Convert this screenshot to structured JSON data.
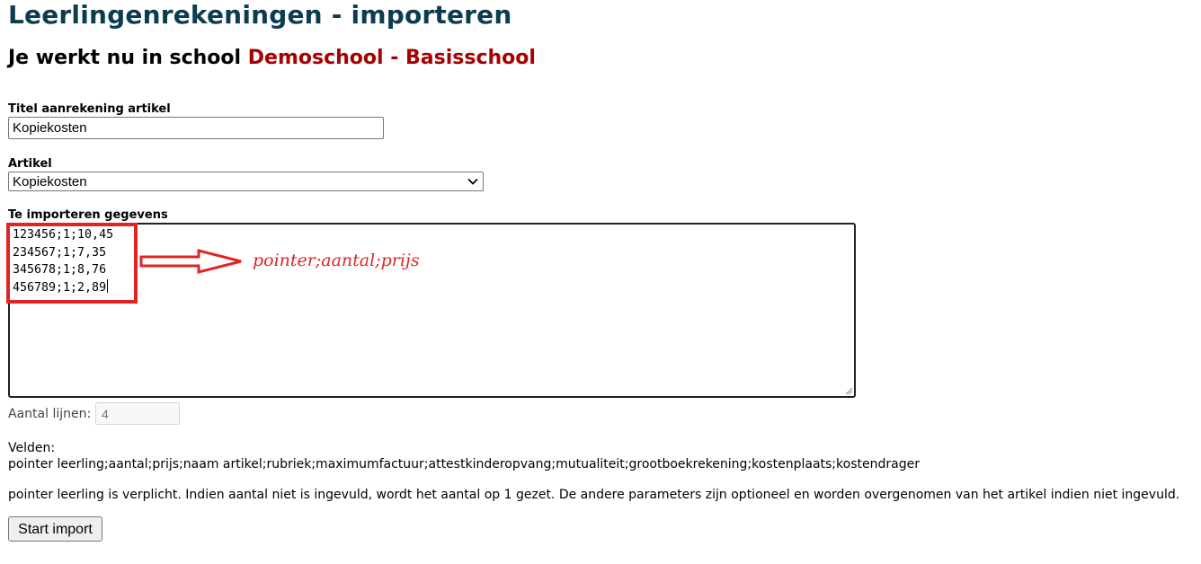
{
  "header": {
    "title": "Leerlingenrekeningen - importeren",
    "school_prefix": "Je werkt nu in school",
    "school_name": "Demoschool - Basisschool"
  },
  "form": {
    "title_label": "Titel aanrekening artikel",
    "title_value": "Kopiekosten",
    "article_label": "Artikel",
    "article_selected": "Kopiekosten",
    "data_label": "Te importeren gegevens",
    "data_lines": "123456;1;10,45\n234567;1;7,35\n345678;1;8,76\n456789;1;2,89",
    "annotation": "pointer;aantal;prijs",
    "line_count_label": "Aantal lijnen:",
    "line_count_value": "4"
  },
  "fields": {
    "title": "Velden:",
    "list": "pointer leerling;aantal;prijs;naam artikel;rubriek;maximumfactuur;attestkinderopvang;mutualiteit;grootboekrekening;kostenplaats;kostendrager"
  },
  "info": "pointer leerling is verplicht. Indien aantal niet is ingevuld, wordt het aantal op 1 gezet. De andere parameters zijn optioneel en worden overgenomen van het artikel indien niet ingevuld.",
  "actions": {
    "start_label": "Start import"
  },
  "icons": {
    "select_chevron": "chevron-down-icon",
    "annotation_arrow": "arrow-right-icon",
    "resize": "resize-grip-icon"
  },
  "colors": {
    "title": "#0b3d4f",
    "school_name": "#a80000",
    "annotation": "#e02424"
  }
}
